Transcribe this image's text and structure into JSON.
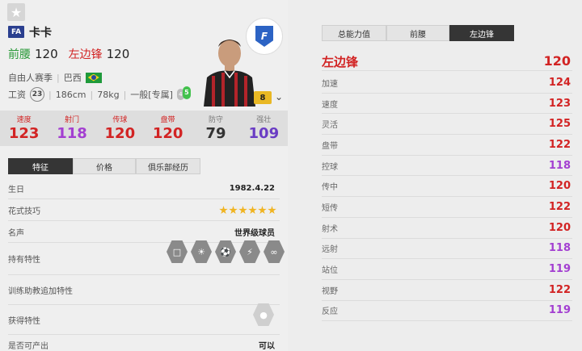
{
  "player": {
    "card_badge": "FA",
    "name": "卡卡",
    "pos1_label": "前腰",
    "pos1_value": "120",
    "pos2_label": "左边锋",
    "pos2_value": "120",
    "season": "自由人赛季",
    "nationality": "巴西",
    "wage_label": "工资",
    "wage": "23",
    "height": "186cm",
    "weight": "78kg",
    "body_type": "一般[专属]",
    "weak_foot": "4",
    "strong_foot": "5",
    "level": "8"
  },
  "attributes": [
    {
      "label": "速度",
      "value": "123",
      "color": "#d22323",
      "labelRed": true
    },
    {
      "label": "射门",
      "value": "118",
      "color": "#a33fd1",
      "labelRed": true
    },
    {
      "label": "传球",
      "value": "120",
      "color": "#d22323",
      "labelRed": true
    },
    {
      "label": "盘带",
      "value": "120",
      "color": "#d22323",
      "labelRed": true
    },
    {
      "label": "防守",
      "value": "79",
      "color": "#333333",
      "labelRed": false
    },
    {
      "label": "强壮",
      "value": "109",
      "color": "#6a3cc4",
      "labelRed": false
    }
  ],
  "left_tabs": [
    "特征",
    "价格",
    "俱乐部经历"
  ],
  "info": {
    "birthday_label": "生日",
    "birthday": "1982.4.22",
    "skill_label": "花式技巧",
    "fame_label": "名声",
    "fame": "世界级球员",
    "traits_label": "持有特性",
    "coach_label": "训练助教追加特性",
    "acquired_label": "获得特性",
    "produce_label": "是否可产出",
    "produce": "可以"
  },
  "right_tabs": [
    "总能力值",
    "前腰",
    "左边锋"
  ],
  "position_rating": {
    "label": "左边锋",
    "value": "120"
  },
  "ratings": [
    {
      "label": "加速",
      "value": "124",
      "color": "#d22323"
    },
    {
      "label": "速度",
      "value": "123",
      "color": "#d22323"
    },
    {
      "label": "灵活",
      "value": "125",
      "color": "#d22323"
    },
    {
      "label": "盘带",
      "value": "122",
      "color": "#d22323"
    },
    {
      "label": "控球",
      "value": "118",
      "color": "#a33fd1"
    },
    {
      "label": "传中",
      "value": "120",
      "color": "#d22323"
    },
    {
      "label": "短传",
      "value": "122",
      "color": "#d22323"
    },
    {
      "label": "射术",
      "value": "120",
      "color": "#d22323"
    },
    {
      "label": "远射",
      "value": "118",
      "color": "#a33fd1"
    },
    {
      "label": "站位",
      "value": "119",
      "color": "#a33fd1"
    },
    {
      "label": "视野",
      "value": "122",
      "color": "#d22323"
    },
    {
      "label": "反应",
      "value": "119",
      "color": "#a33fd1"
    }
  ]
}
